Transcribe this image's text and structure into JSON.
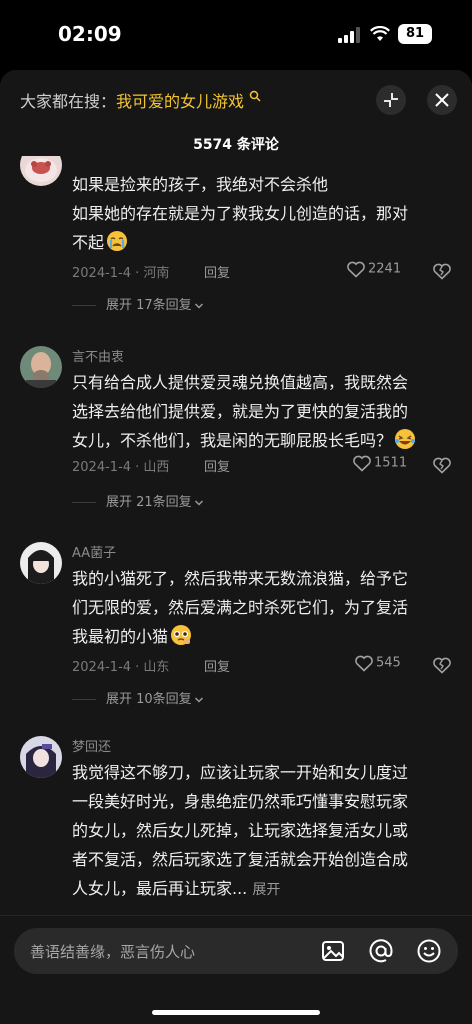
{
  "status": {
    "time": "02:09",
    "battery": "81"
  },
  "search": {
    "prefix": "大家都在搜：",
    "term": "我可爱的女儿游戏"
  },
  "header": {
    "comment_count": "5574 条评论"
  },
  "comments": [
    {
      "user": "",
      "lines": [
        "如果是捡来的孩子，我绝对不会杀他",
        "如果她的存在就是为了救我女儿创造的话，那对",
        "不起"
      ],
      "date_loc": "2024-1-4 · 河南",
      "reply": "回复",
      "likes": "2241",
      "expand": "展开 17条回复"
    },
    {
      "user": "言不由衷",
      "lines": [
        "只有给合成人提供爱灵魂兑换值越高，我既然会",
        "选择去给他们提供爱，就是为了更快的复活我的",
        "女儿，不杀他们，我是闲的无聊屁股长毛吗？"
      ],
      "date_loc": "2024-1-4 · 山西",
      "reply": "回复",
      "likes": "1511",
      "expand": "展开 21条回复"
    },
    {
      "user": "AA菌子",
      "lines": [
        "我的小猫死了，然后我带来无数流浪猫，给予它",
        "们无限的爱，然后爱满之时杀死它们，为了复活",
        "我最初的小猫"
      ],
      "date_loc": "2024-1-4 · 山东",
      "reply": "回复",
      "likes": "545",
      "expand": "展开 10条回复"
    },
    {
      "user": "梦回还",
      "lines": [
        "我觉得这不够刀，应该让玩家一开始和女儿度过",
        "一段美好时光，身患绝症仍然乖巧懂事安慰玩家",
        "的女儿，然后女儿死掉，让玩家选择复活女儿或",
        "者不复活，然后玩家选了复活就会开始创造合成",
        "人女儿，最后再让玩家..."
      ],
      "more": "展开"
    }
  ],
  "input": {
    "placeholder": "善语结善缘，恶言伤人心"
  },
  "colors": {
    "accent": "#f3c532",
    "background": "#161616"
  }
}
